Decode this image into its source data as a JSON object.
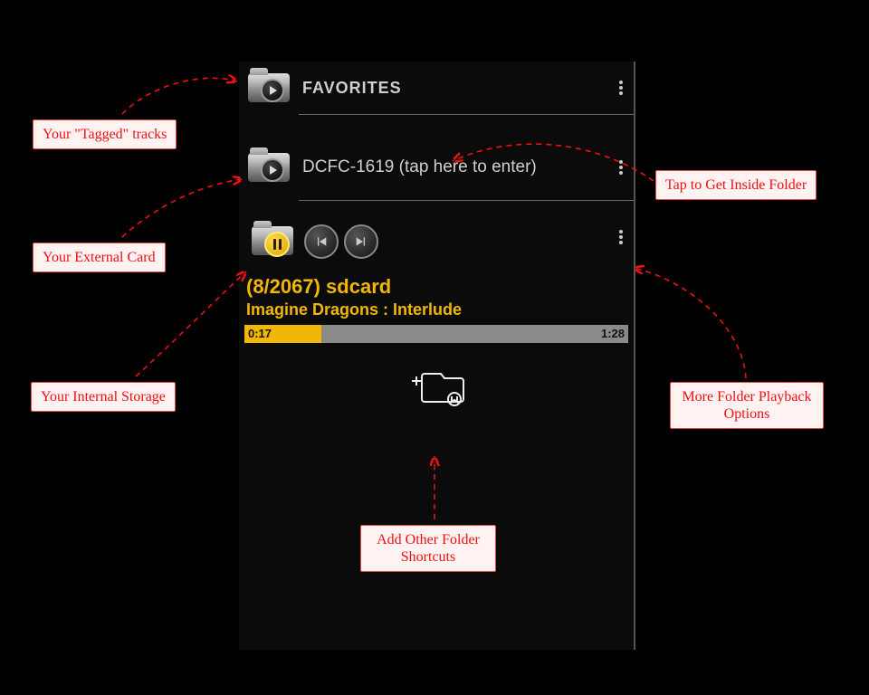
{
  "header": {
    "title": "FAVORITES"
  },
  "folder": {
    "label": "DCFC-1619 (tap here to enter)"
  },
  "player": {
    "counter": "(8/2067)  sdcard",
    "track": "Imagine Dragons : Interlude",
    "elapsed": "0:17",
    "duration": "1:28",
    "progress_percent": 20
  },
  "callouts": {
    "tagged": "Your \"Tagged\" tracks",
    "external": "Your External Card",
    "internal": "Your Internal Storage",
    "inside": "Tap to Get Inside Folder",
    "more": "More Folder Playback Options",
    "add": "Add Other Folder Shortcuts"
  },
  "colors": {
    "accent": "#f2b705",
    "callout_red": "#e11"
  }
}
